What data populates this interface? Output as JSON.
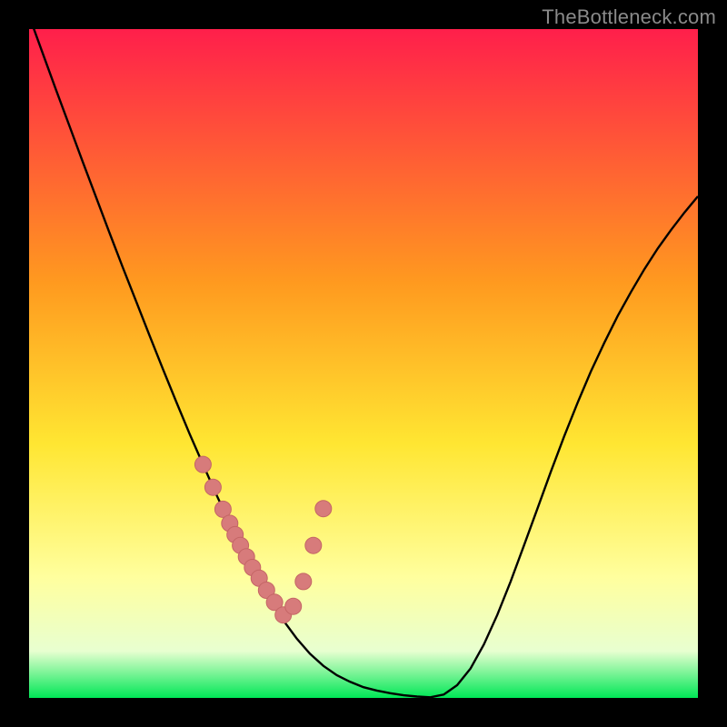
{
  "watermark": "TheBottleneck.com",
  "colors": {
    "frame": "#000000",
    "curve": "#000000",
    "marker_fill": "#d77b7b",
    "marker_stroke": "#c46565",
    "gradient_top": "#ff1f4b",
    "gradient_mid_upper": "#ff9a1f",
    "gradient_mid": "#ffe632",
    "gradient_mid_lower": "#ffff9e",
    "gradient_lower": "#e8ffd0",
    "gradient_bottom": "#00e756"
  },
  "chart_data": {
    "type": "line",
    "title": "",
    "xlabel": "",
    "ylabel": "",
    "xlim": [
      0,
      100
    ],
    "ylim": [
      0,
      100
    ],
    "grid": false,
    "legend": false,
    "series": [
      {
        "name": "bottleneck-curve",
        "x": [
          0,
          2,
          4,
          6,
          8,
          10,
          12,
          14,
          16,
          18,
          20,
          22,
          24,
          26,
          28,
          30,
          32,
          34,
          36,
          38,
          40,
          42,
          44,
          46,
          48,
          50,
          52,
          54,
          56,
          58,
          60,
          62,
          64,
          66,
          68,
          70,
          72,
          74,
          76,
          78,
          80,
          82,
          84,
          86,
          88,
          90,
          92,
          94,
          96,
          98,
          100
        ],
        "y": [
          102,
          96.5,
          91,
          85.6,
          80.2,
          74.9,
          69.6,
          64.4,
          59.3,
          54.2,
          49.2,
          44.3,
          39.5,
          34.9,
          30.4,
          26.1,
          22.0,
          18.2,
          14.7,
          11.6,
          8.9,
          6.6,
          4.8,
          3.4,
          2.4,
          1.6,
          1.1,
          0.7,
          0.4,
          0.2,
          0.1,
          0.5,
          1.9,
          4.4,
          8.0,
          12.4,
          17.4,
          22.8,
          28.3,
          33.8,
          39.1,
          44.1,
          48.8,
          53.1,
          57.1,
          60.7,
          64.1,
          67.2,
          70.0,
          72.6,
          75.0
        ]
      }
    ],
    "markers": {
      "name": "highlighted-points",
      "x": [
        26.0,
        27.5,
        29.0,
        30.0,
        30.8,
        31.6,
        32.5,
        33.4,
        34.4,
        35.5,
        36.7,
        38.0,
        39.5,
        41.0,
        42.5,
        44.0
      ],
      "y": [
        34.9,
        31.5,
        28.2,
        26.1,
        24.4,
        22.8,
        21.1,
        19.5,
        17.9,
        16.1,
        14.3,
        12.4,
        13.7,
        17.4,
        22.8,
        28.3
      ]
    },
    "annotations": []
  }
}
